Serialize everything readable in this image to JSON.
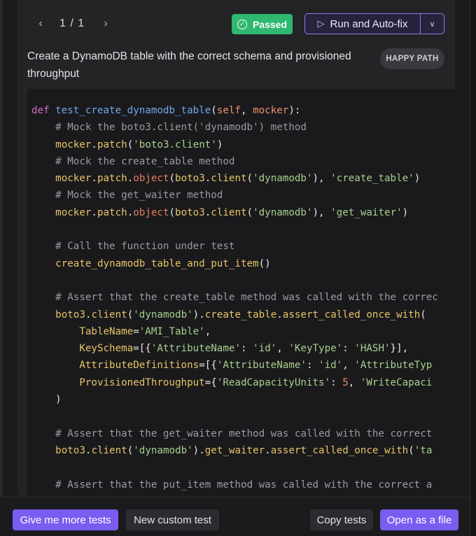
{
  "header": {
    "pager": "1 / 1",
    "status": "Passed",
    "run_label": "Run and Auto-fix"
  },
  "test": {
    "description": "Create a DynamoDB table with the correct schema and provisioned throughput",
    "tag": "HAPPY PATH"
  },
  "code_lines": [
    "def test_create_dynamodb_table(self, mocker):",
    "    # Mock the boto3.client('dynamodb') method",
    "    mocker.patch('boto3.client')",
    "    # Mock the create_table method",
    "    mocker.patch.object(boto3.client('dynamodb'), 'create_table')",
    "    # Mock the get_waiter method",
    "    mocker.patch.object(boto3.client('dynamodb'), 'get_waiter')",
    "",
    "    # Call the function under test",
    "    create_dynamodb_table_and_put_item()",
    "",
    "    # Assert that the create_table method was called with the correc",
    "    boto3.client('dynamodb').create_table.assert_called_once_with(",
    "        TableName='AMI_Table',",
    "        KeySchema=[{'AttributeName': 'id', 'KeyType': 'HASH'}],",
    "        AttributeDefinitions=[{'AttributeName': 'id', 'AttributeTyp",
    "        ProvisionedThroughput={'ReadCapacityUnits': 5, 'WriteCapaci",
    "    )",
    "",
    "    # Assert that the get_waiter method was called with the correct",
    "    boto3.client('dynamodb').get_waiter.assert_called_once_with('ta",
    "",
    "    # Assert that the put_item method was called with the correct a"
  ],
  "footer": {
    "more_tests": "Give me more tests",
    "custom_test": "New custom test",
    "copy_tests": "Copy tests",
    "open_file": "Open as a file"
  },
  "colors": {
    "accent": "#7b5cf0",
    "passed": "#2fb86f",
    "keyword": "#d46cc4",
    "function": "#6fa6ef",
    "string": "#a8d08d",
    "comment": "#9a9aa2"
  }
}
